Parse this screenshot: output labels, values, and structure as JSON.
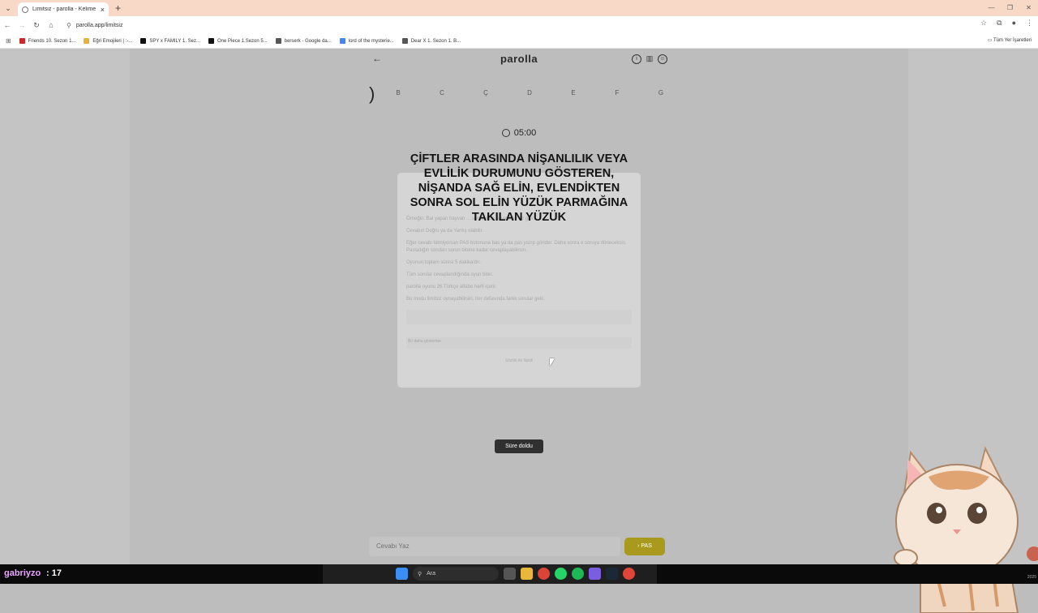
{
  "browser": {
    "tab_title": "Limitsiz - parolla - Kelime oyunu",
    "url": "parolla.app/limitsiz",
    "bookmarks": [
      {
        "label": "Friends 10. Sezon 1...",
        "color": "#cc2a2a"
      },
      {
        "label": "Eğri Emojileri | :-...",
        "color": "#e3b33a"
      },
      {
        "label": "SPY x FAMILY 1. Sez...",
        "color": "#111111"
      },
      {
        "label": "One Piece 1.Sezon 5...",
        "color": "#111111"
      },
      {
        "label": "berserk - Google da...",
        "color": "#555555"
      },
      {
        "label": "lord of the mysterie...",
        "color": "#4285f4"
      },
      {
        "label": "Dear X 1. Sezon 1. B...",
        "color": "#555555"
      }
    ],
    "all_bookmarks": "Tüm Yer İşaretleri"
  },
  "app": {
    "logo": "parolla",
    "letters": [
      "B",
      "C",
      "Ç",
      "D",
      "E",
      "F",
      "G"
    ],
    "timer": "05:00",
    "question": "ÇİFTLER ARASINDA NİŞANLILIK VEYA EVLİLİK DURUMUNU GÖSTEREN, NİŞANDA SAĞ ELİN, EVLENDİKTEN SONRA SOL ELİN YÜZÜK PARMAĞINA TAKILAN YÜZÜK",
    "modal": {
      "line1": "Örneğin: Bal yapan hayvan ... sorusunun cevabı Arı'dır gibi.",
      "line2": "Cevabın Doğru ya da Yanlış olabilir.",
      "line3": "Eğer cevabı bilmiyorsan PAS butonuna bas ya da pas yazıp gönder. Daha sonra o soruya döneceksin. Pasladığın soruları sorun bitene kadar cevaplayabilirsin.",
      "line4": "Oyunun toplam süresi 5 dakika'dır.",
      "line5": "Tüm sorular cevaplandığında oyun biter.",
      "line6": "parolla oyunu 26 Türkçe alfabe harfi içerir.",
      "line7": "Bu modu limitsiz oynayabilirsin, her defasında farklı sorular gelir.",
      "checkbox": "Bir daha gösterme",
      "footer": "Sözlük ile ilişkili"
    },
    "toast": "Süre doldu",
    "answer_placeholder": "Cevabı Yaz",
    "pas_label": "PAS"
  },
  "taskbar": {
    "user": "gabriyzo",
    "count": ": 17",
    "search": "Ara",
    "year": "2025"
  }
}
